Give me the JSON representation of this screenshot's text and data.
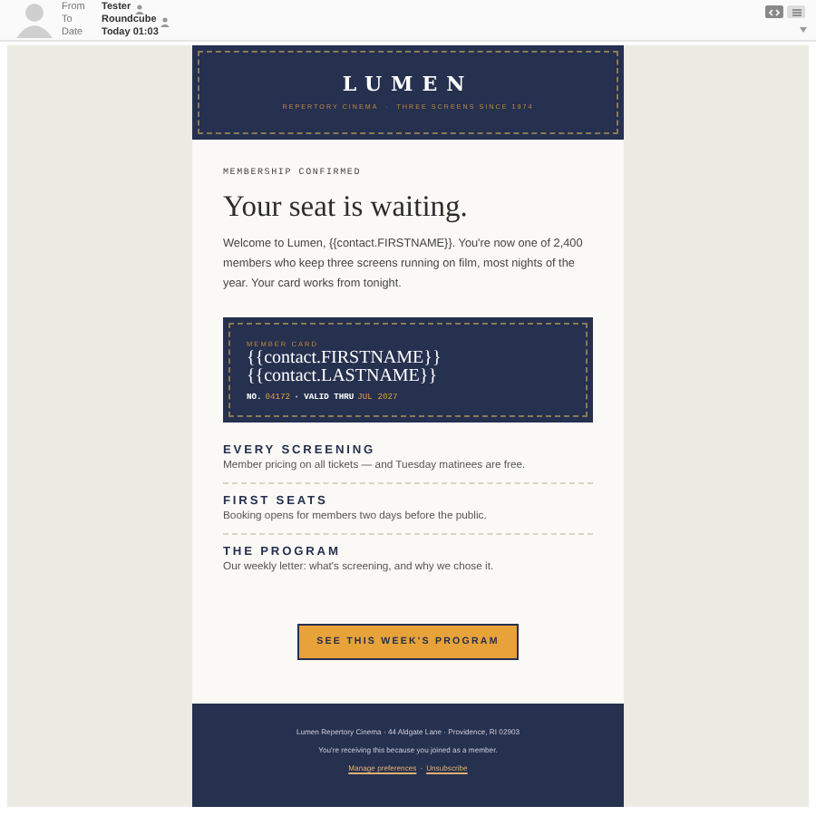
{
  "mail_header": {
    "fields": [
      {
        "label": "From",
        "value": "Tester",
        "contact_icon": true
      },
      {
        "label": "To",
        "value": "Roundcube",
        "contact_icon": true
      },
      {
        "label": "Date",
        "value": "Today 01:03",
        "contact_icon": false
      }
    ]
  },
  "email": {
    "brand": "LUMEN",
    "tagline": "REPERTORY CINEMA  ·  THREE SCREENS SINCE 1974",
    "eyebrow": "MEMBERSHIP CONFIRMED",
    "headline": "Your seat is waiting.",
    "intro": "Welcome to Lumen, {{contact.FIRSTNAME}}. You're now one of 2,400 members who keep three screens running on film, most nights of the year. Your card works from tonight.",
    "card": {
      "label": "MEMBER CARD",
      "lines": [
        "{{contact.FIRSTNAME}}",
        "{{contact.LASTNAME}}"
      ],
      "details": [
        {
          "text": "NO.",
          "highlight": false
        },
        {
          "text": "04172",
          "highlight": true
        },
        {
          "text": "· VALID THRU",
          "highlight": false
        },
        {
          "text": "JUL 2027",
          "highlight": true
        }
      ]
    },
    "perks": [
      {
        "title": "EVERY SCREENING",
        "text": "Member pricing on all tickets — and Tuesday matinees are free."
      },
      {
        "title": "FIRST SEATS",
        "text": "Booking opens for members two days before the public."
      },
      {
        "title": "THE PROGRAM",
        "text": "Our weekly letter: what's screening, and why we chose it."
      }
    ],
    "button": "SEE THIS WEEK'S PROGRAM",
    "footer": {
      "address": "Lumen Repertory Cinema · 44 Aldgate Lane · Providence, RI 02903",
      "notice": "You're receiving this because you joined as a member.",
      "links": [
        "Manage preferences",
        "Unsubscribe"
      ],
      "separator": "·"
    }
  }
}
